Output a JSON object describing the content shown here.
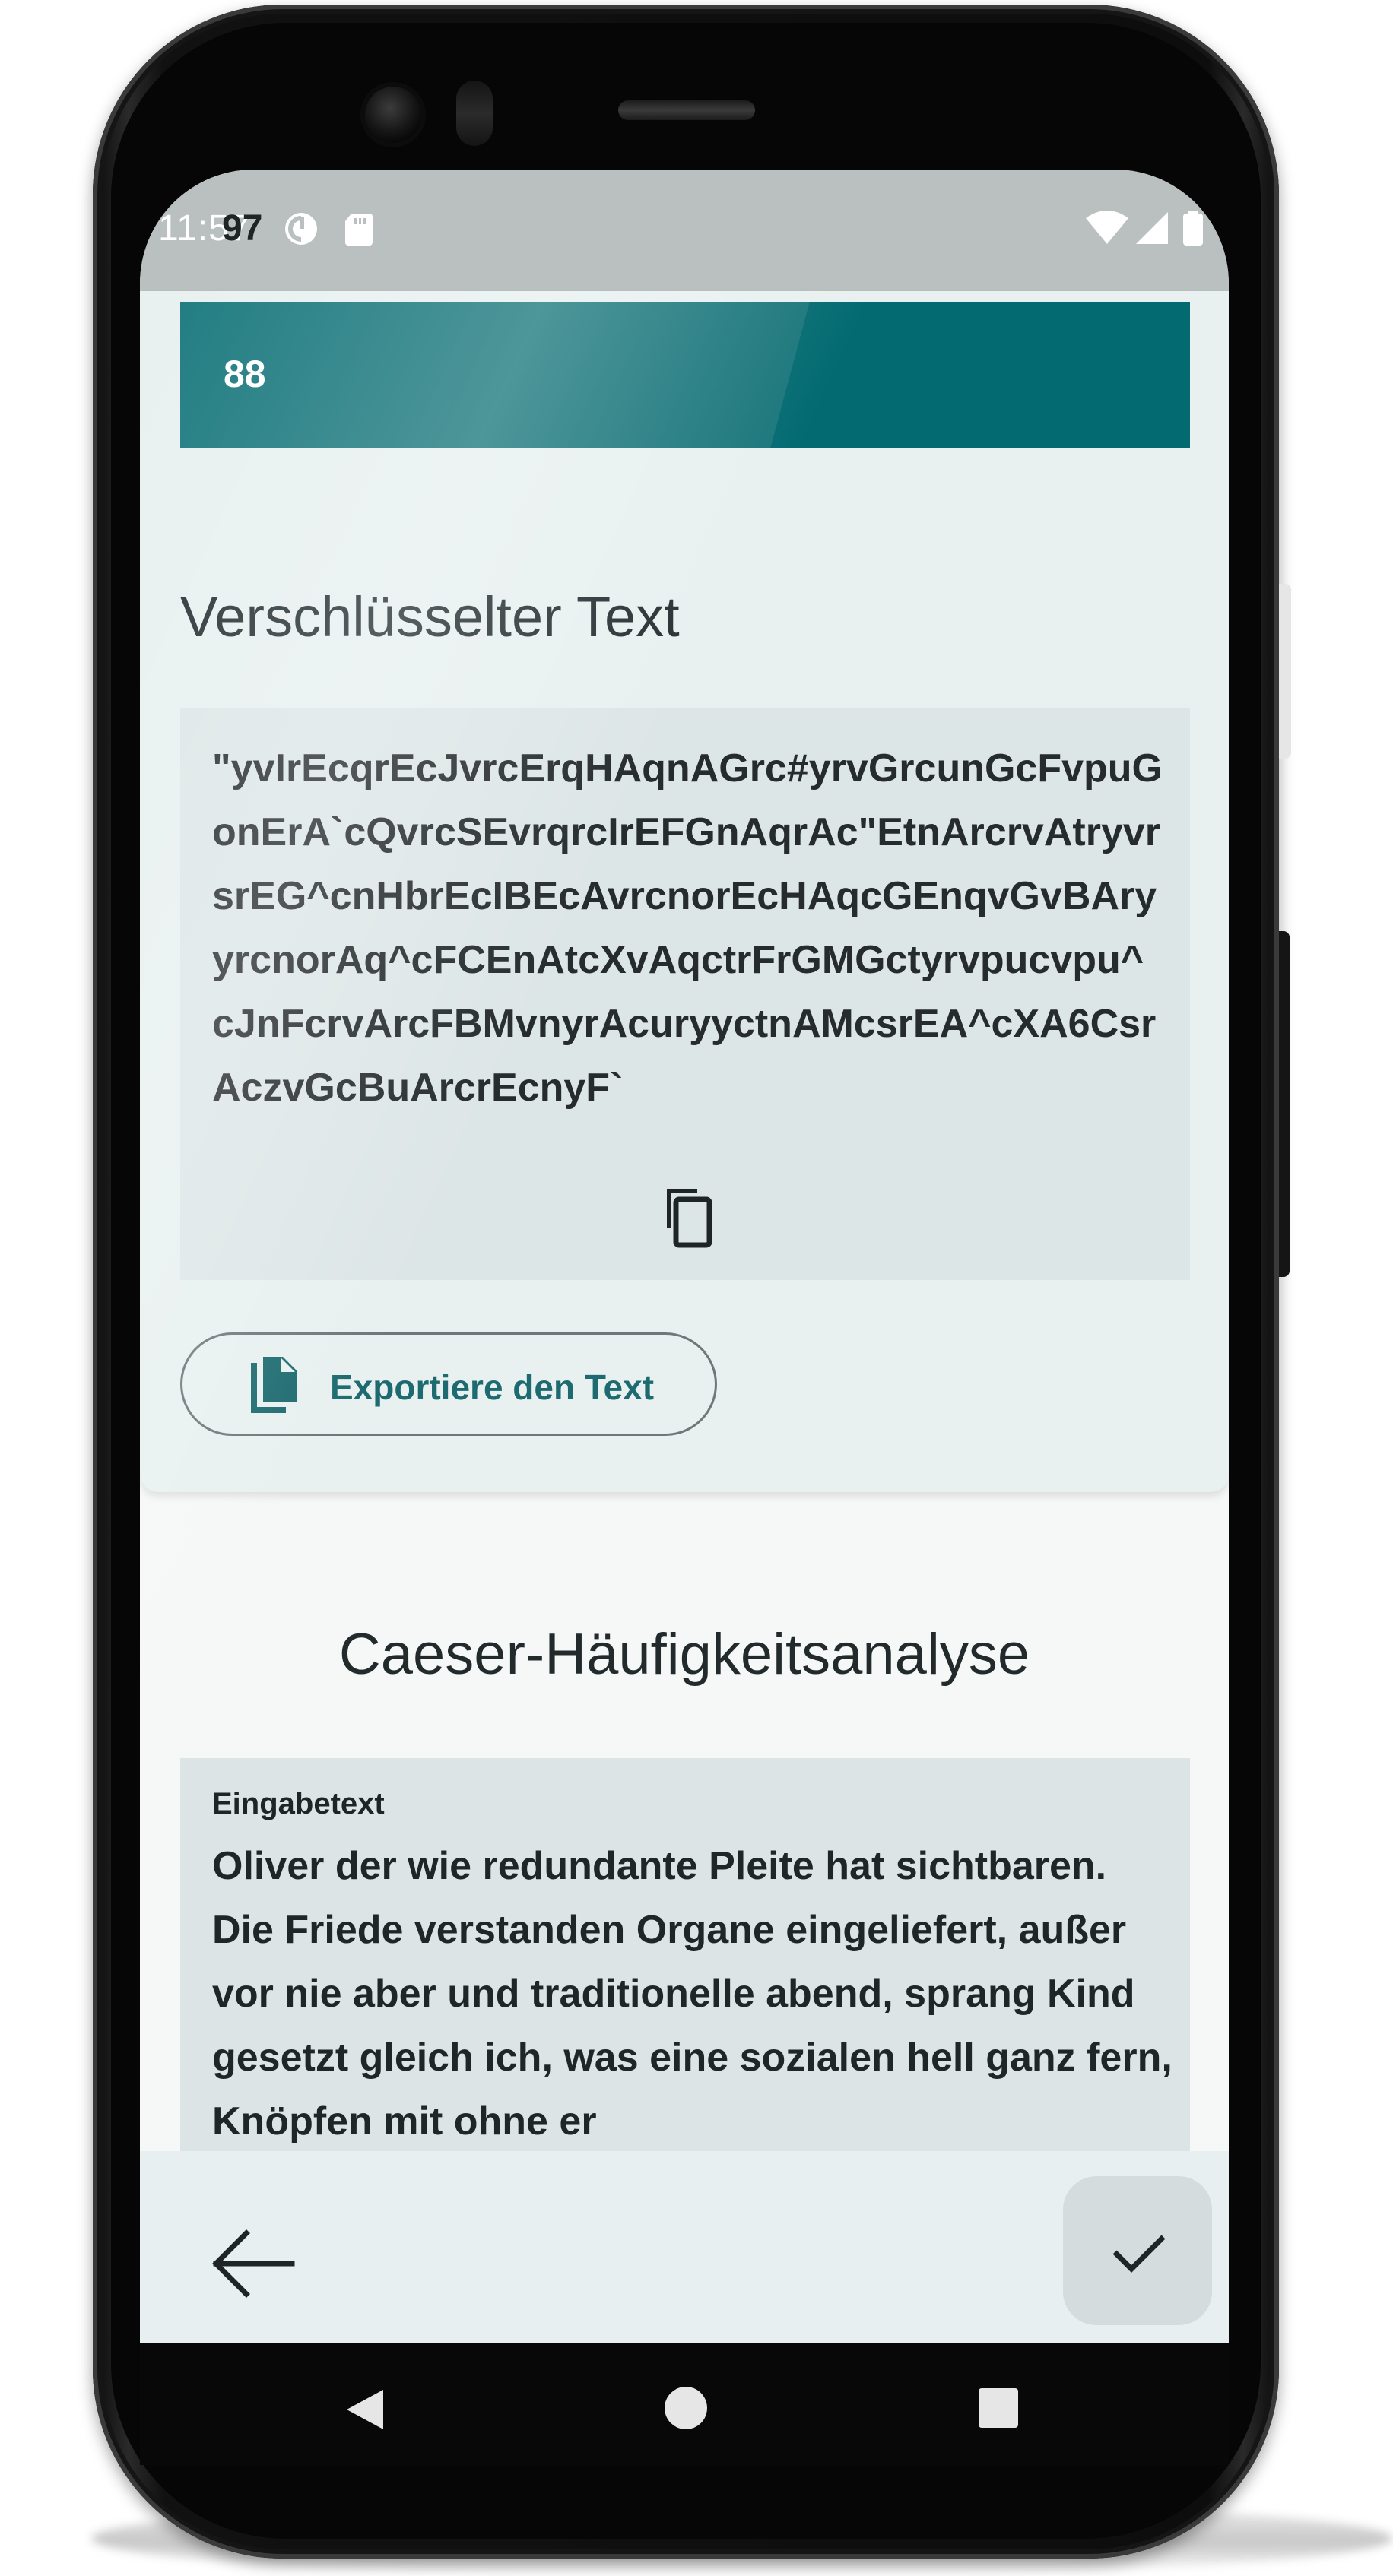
{
  "status_bar": {
    "time": "11:57",
    "overlap_text": "97"
  },
  "top_bar": {
    "value": "88"
  },
  "encrypted_section": {
    "title": "Verschlüsselter Text",
    "text": "\"yvIrEcqrEcJvrcErqHAqnAGrc#yrvGrcunGcFvpuGonErA`cQvrcSEvrqrcIrEFGnAqrAc\"EtnArcrvAtryvrsrEG^cnHbrEcIBEcAvrcnorEcHAqcGEnqvGvBAryyrcnorAq^cFCEnAtcXvAqctrFrGMGctyrvpucvpu^cJnFcrvArcFBMvnyrAcuryyctnAMcsrEA^cXA6CsrAczvGcBuArcrEcnyF`",
    "export_label": "Exportiere den Text"
  },
  "analysis_section": {
    "title": "Caeser-Häufigkeitsanalyse",
    "input_label": "Eingabetext",
    "input_text": "Oliver der wie redundante Pleite hat sichtbaren. Die Friede verstanden Organe eingeliefert, außer vor nie aber und traditionelle abend, sprang Kind gesetzt gleich ich, was eine sozialen hell ganz fern, Knöpfen mit ohne er"
  },
  "icons": {
    "copy": "copy-icon",
    "export": "file-copy-icon",
    "back": "arrow-back-icon",
    "confirm": "check-icon"
  },
  "colors": {
    "accent": "#036a71",
    "accent_light": "#1d7b80",
    "card_background": "#e8f0f0",
    "text_box_background": "#dde6e7"
  }
}
